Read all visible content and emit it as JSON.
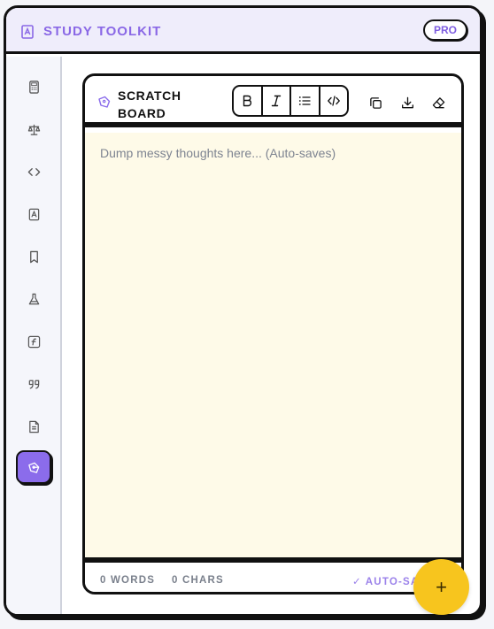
{
  "header": {
    "title": "STUDY TOOLKIT",
    "badge": "PRO",
    "logo_icon": "book-icon"
  },
  "sidebar": {
    "items": [
      {
        "icon": "calculator-icon"
      },
      {
        "icon": "scales-icon"
      },
      {
        "icon": "code-icon"
      },
      {
        "icon": "book-icon"
      },
      {
        "icon": "bookmark-icon"
      },
      {
        "icon": "flask-icon"
      },
      {
        "icon": "function-icon"
      },
      {
        "icon": "quote-icon"
      },
      {
        "icon": "document-icon"
      },
      {
        "icon": "pen-tool-icon",
        "active": true
      }
    ]
  },
  "scratch": {
    "title_line1": "SCRATCH",
    "title_line2": "BOARD",
    "format_tools": [
      "bold-icon",
      "italic-icon",
      "list-icon",
      "code-icon"
    ],
    "actions": [
      "copy-icon",
      "download-icon",
      "eraser-icon"
    ],
    "placeholder": "Dump messy thoughts here... (Auto-saves)",
    "value": ""
  },
  "footer": {
    "words": "0 WORDS",
    "chars": "0 CHARS",
    "autosave": "✓ AUTO-SAVED"
  },
  "fab": {
    "label": "+"
  },
  "colors": {
    "accent": "#8b6ceb",
    "header_bg": "#efedfb",
    "editor_bg": "#fefae8",
    "fab": "#f7c51e",
    "border": "#111111"
  }
}
